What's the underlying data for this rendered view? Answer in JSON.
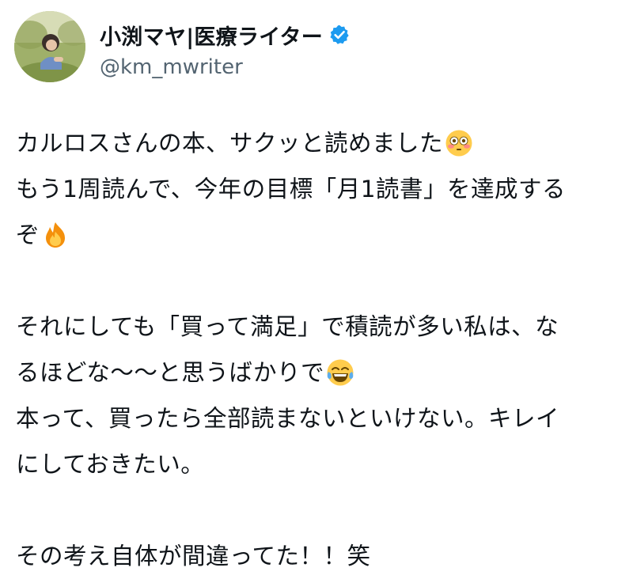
{
  "user": {
    "display_name": "小渕マヤ|医療ライター",
    "handle": "@km_mwriter",
    "avatar_icon": "profile-photo-avatar",
    "verified_icon": "verified-badge-icon"
  },
  "colors": {
    "text": "#0f1419",
    "handle": "#536471",
    "verified": "#1d9bf0"
  },
  "tweet": {
    "lines": [
      "カルロスさんの本、サクッと読めました",
      "もう1周読んで、今年の目標「月1読書」を達成する",
      "ぞ",
      "",
      "それにしても「買って満足」で積読が多い私は、な",
      "るほどな〜〜と思うばかりで",
      "本って、買ったら全部読まないといけない。キレイ",
      "にしておきたい。",
      "",
      "その考え自体が間違ってた！！笑"
    ],
    "emojis": {
      "line1": "flushed-face-emoji",
      "line3": "fire-emoji",
      "line6": "tears-of-joy-emoji"
    }
  }
}
